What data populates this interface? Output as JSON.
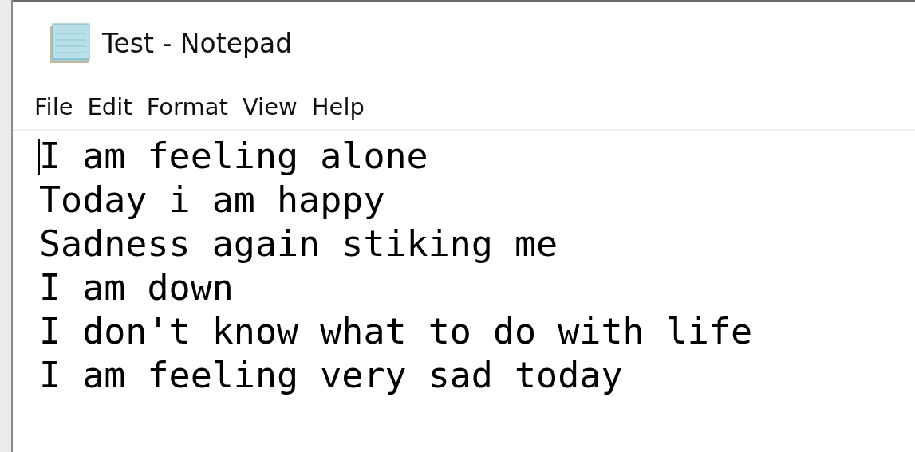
{
  "window": {
    "title": "Test - Notepad"
  },
  "menu": [
    "File",
    "Edit",
    "Format",
    "View",
    "Help"
  ],
  "editor": {
    "lines": [
      "I am feeling alone",
      "Today i am happy",
      "Sadness again stiking me",
      "I am down",
      "I don't know what to do with life",
      "I am feeling very sad today"
    ]
  }
}
